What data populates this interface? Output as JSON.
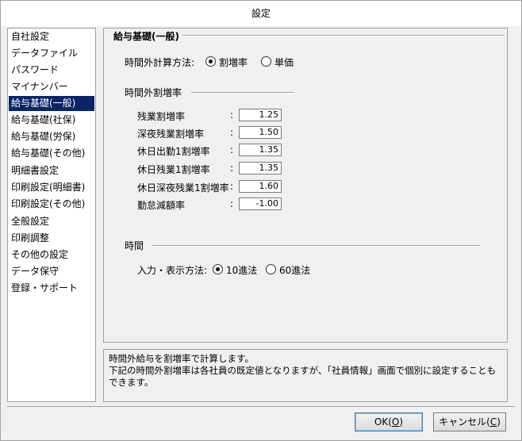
{
  "window": {
    "title": "設定"
  },
  "sidebar": {
    "items": [
      {
        "label": "自社設定"
      },
      {
        "label": "データファイル"
      },
      {
        "label": "パスワード"
      },
      {
        "label": "マイナンバー"
      },
      {
        "label": "給与基礎(一般)",
        "selected": true
      },
      {
        "label": "給与基礎(社保)"
      },
      {
        "label": "給与基礎(労保)"
      },
      {
        "label": "給与基礎(その他)"
      },
      {
        "label": "明細書設定"
      },
      {
        "label": "印刷設定(明細書)"
      },
      {
        "label": "印刷設定(その他)"
      },
      {
        "label": "全般設定"
      },
      {
        "label": "印刷調整"
      },
      {
        "label": "その他の設定"
      },
      {
        "label": "データ保守"
      },
      {
        "label": "登録・サポート"
      }
    ]
  },
  "main": {
    "section_title": "給与基礎(一般)",
    "calc_method": {
      "label": "時間外計算方法:",
      "options": [
        "割増率",
        "単価"
      ],
      "selected": "割増率"
    },
    "overtime_group": {
      "title": "時間外割増率",
      "rows": [
        {
          "label": "残業割増率",
          "value": "1.25"
        },
        {
          "label": "深夜残業割増率",
          "value": "1.50"
        },
        {
          "label": "休日出勤1割増率",
          "value": "1.35"
        },
        {
          "label": "休日残業1割増率",
          "value": "1.35"
        },
        {
          "label": "休日深夜残業1割増率",
          "value": "1.60"
        },
        {
          "label": "勤怠減額率",
          "value": "-1.00"
        }
      ],
      "colon": ":"
    },
    "time_group": {
      "title": "時間",
      "input_label": "入力・表示方法:",
      "options": [
        "10進法",
        "60進法"
      ],
      "selected": "10進法"
    }
  },
  "description": {
    "line1": "時間外給与を割増率で計算します。",
    "line2": "下記の時間外割増率は各社員の既定値となりますが、「社員情報」画面で個別に設定することもできます。"
  },
  "buttons": {
    "ok_label": "OK(",
    "ok_key": "O",
    "cancel_label": "キャンセル(",
    "cancel_key": "C",
    "close_paren": ")"
  }
}
